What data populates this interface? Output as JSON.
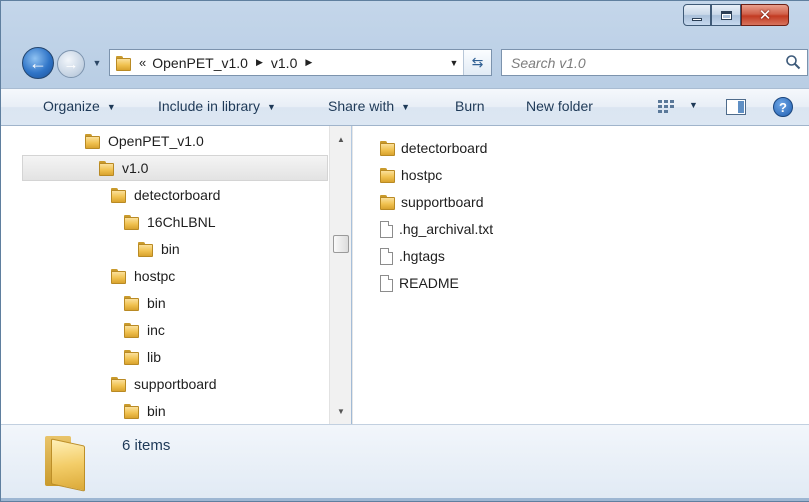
{
  "window": {
    "caption_buttons": {
      "minimize": "minimize",
      "maximize": "maximize",
      "close": "close"
    }
  },
  "nav": {
    "back_icon": "back-arrow-icon",
    "forward_icon": "forward-arrow-icon",
    "breadcrumb_overflow": "«",
    "breadcrumbs": [
      "OpenPET_v1.0",
      "v1.0"
    ],
    "search_placeholder": "Search v1.0"
  },
  "toolbar": {
    "organize": "Organize",
    "include_in_library": "Include in library",
    "share_with": "Share with",
    "burn": "Burn",
    "new_folder": "New folder"
  },
  "tree": {
    "items": [
      {
        "label": "OpenPET_v1.0",
        "depth": 0
      },
      {
        "label": "v1.0",
        "depth": 1,
        "selected": true
      },
      {
        "label": "detectorboard",
        "depth": 2
      },
      {
        "label": "16ChLBNL",
        "depth": 3
      },
      {
        "label": "bin",
        "depth": 4
      },
      {
        "label": "hostpc",
        "depth": 2
      },
      {
        "label": "bin",
        "depth": 3
      },
      {
        "label": "inc",
        "depth": 3
      },
      {
        "label": "lib",
        "depth": 3
      },
      {
        "label": "supportboard",
        "depth": 2
      },
      {
        "label": "bin",
        "depth": 3
      }
    ]
  },
  "files": [
    {
      "name": "detectorboard",
      "type": "folder"
    },
    {
      "name": "hostpc",
      "type": "folder"
    },
    {
      "name": "supportboard",
      "type": "folder"
    },
    {
      "name": ".hg_archival.txt",
      "type": "file"
    },
    {
      "name": ".hgtags",
      "type": "file"
    },
    {
      "name": "README",
      "type": "file"
    }
  ],
  "details": {
    "item_count": "6 items"
  },
  "colors": {
    "frame": "#a7c0db",
    "close_button": "#c23b22",
    "folder": "#f0c14f"
  }
}
